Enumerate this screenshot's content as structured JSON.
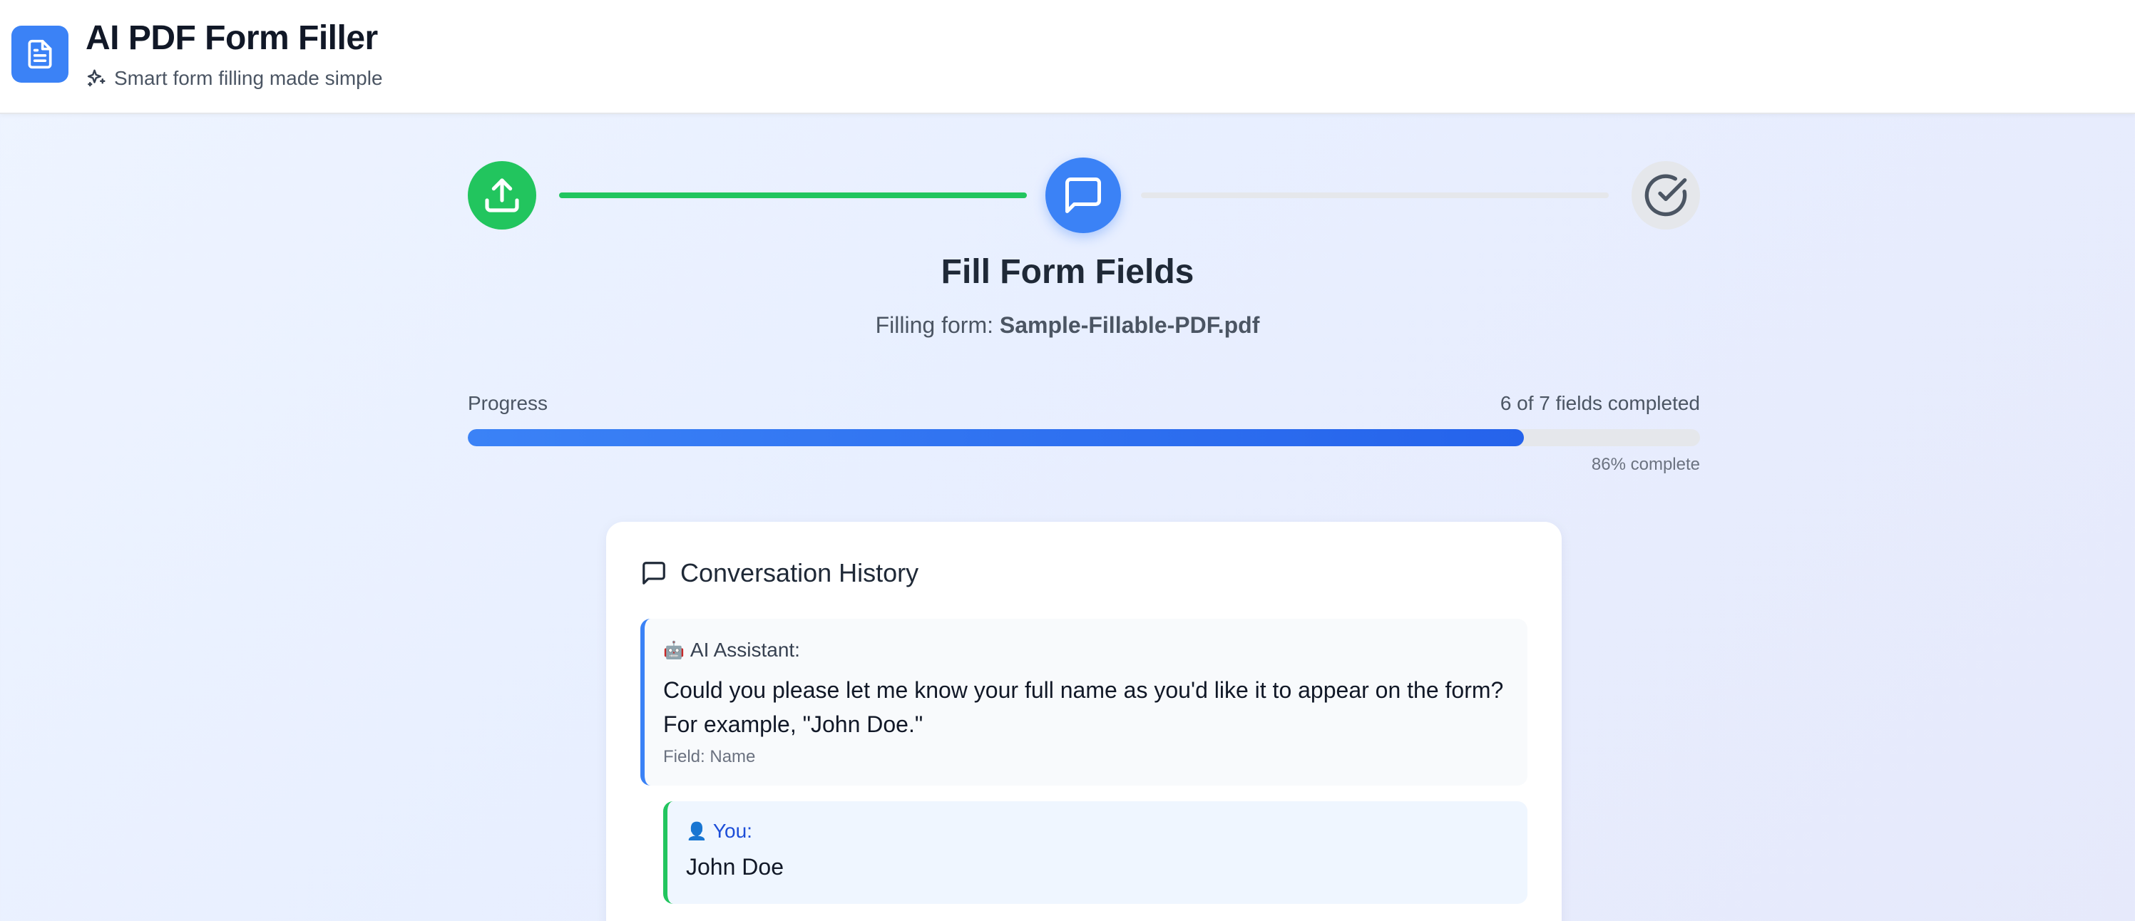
{
  "header": {
    "title": "AI PDF Form Filler",
    "subtitle": "Smart form filling made simple",
    "logo_icon": "document-icon",
    "subtitle_icon": "sparkles-icon"
  },
  "stepper": {
    "steps": [
      {
        "icon": "upload-icon",
        "state": "completed",
        "color": "#22c55e"
      },
      {
        "icon": "chat-bubble-icon",
        "state": "active",
        "color": "#3b82f6"
      },
      {
        "icon": "check-circle-icon",
        "state": "pending",
        "color": "#e5e7eb"
      }
    ]
  },
  "step": {
    "title": "Fill Form Fields",
    "filling_prefix": "Filling form: ",
    "filename": "Sample-Fillable-PDF.pdf"
  },
  "progress": {
    "label": "Progress",
    "count_text": "6 of 7 fields completed",
    "percent_text": "86% complete",
    "fraction": 0.857
  },
  "conversation": {
    "title": "Conversation History",
    "messages": [
      {
        "role": "assistant",
        "emoji": "🤖",
        "sender": "AI Assistant:",
        "text": "Could you please let me know your full name as you'd like it to appear on the form? For example, \"John Doe.\"",
        "field": "Field: Name"
      },
      {
        "role": "user",
        "emoji": "👤",
        "sender": "You:",
        "text": "John Doe"
      }
    ]
  },
  "colors": {
    "accent": "#3b82f6",
    "success": "#22c55e",
    "muted": "#e5e7eb"
  }
}
